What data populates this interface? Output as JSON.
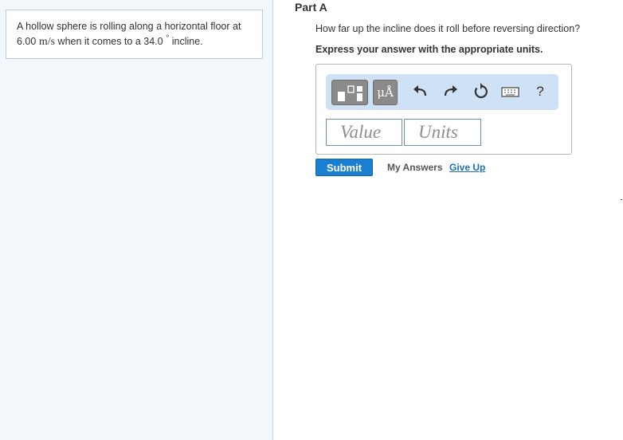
{
  "problem": {
    "text_before": "A hollow sphere is rolling along a horizontal floor at",
    "speed_value": "6.00",
    "speed_unit": "m/s",
    "text_middle": "when it comes to a",
    "angle_value": "34.0",
    "degree_symbol": "°",
    "text_after": "incline."
  },
  "part": {
    "title": "Part A",
    "question": "How far up the incline does it roll before reversing direction?",
    "instruction": "Express your answer with the appropriate units."
  },
  "toolbar": {
    "units_label": "μÅ",
    "help_label": "?"
  },
  "inputs": {
    "value_placeholder": "Value",
    "units_placeholder": "Units"
  },
  "actions": {
    "submit_label": "Submit",
    "my_answers_label": "My Answers",
    "give_up_label": "Give Up"
  },
  "colors": {
    "accent": "#1b7fd1",
    "toolbar_bg": "#cfe2f5",
    "left_pane_bg": "#f2f7fb"
  }
}
